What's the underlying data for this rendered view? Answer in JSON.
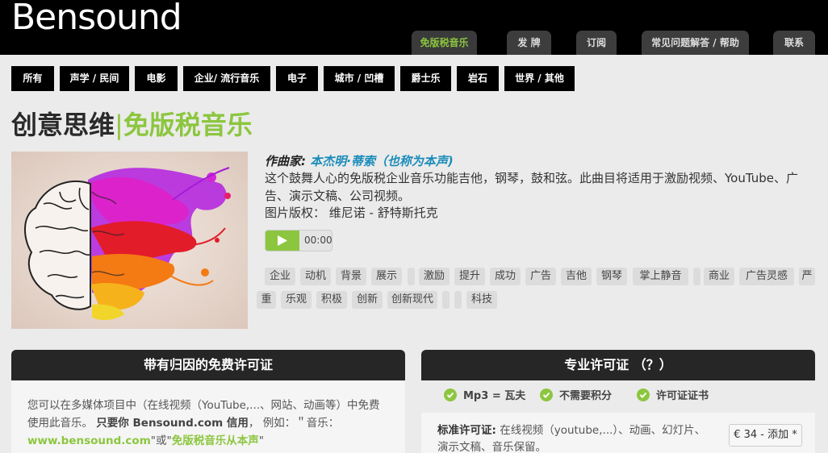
{
  "header": {
    "logo": "Bensound"
  },
  "nav": [
    {
      "label": "免版税音乐",
      "active": true
    },
    {
      "label": "发 牌",
      "active": false
    },
    {
      "label": "订阅",
      "active": false
    },
    {
      "label": "常见问题解答 / 帮助",
      "active": false
    },
    {
      "label": "联系",
      "active": false
    }
  ],
  "categories": [
    "所有",
    "声学 / 民间",
    "电影",
    "企业/ 流行音乐",
    "电子",
    "城市 / 凹槽",
    "爵士乐",
    "岩石",
    "世界 / 其他"
  ],
  "title": {
    "part1": "创意思维",
    "separator": "|",
    "part2": "免版税音乐"
  },
  "composer": {
    "label": "作曲家:",
    "value": "本杰明·蒂索（也称为本声)"
  },
  "description": "这个鼓舞人心的免版税企业音乐功能吉他，钢琴，鼓和弦。此曲目将适用于激励视频、YouTube、广告、演示文稿、公司视频。",
  "credit": "图片版权：  维尼诺 - 舒特斯托克",
  "player": {
    "time": "00:00"
  },
  "tags": [
    "企业",
    "动机",
    "背景",
    "展示",
    "",
    "激励",
    "提升",
    "成功",
    "广告",
    "吉他",
    "钢琴",
    "掌上静音",
    "",
    "商业",
    "广告灵感",
    "严",
    "重",
    "乐观",
    "积极",
    "创新",
    "创新现代",
    "",
    "科技"
  ],
  "free_license": {
    "title": "带有归因的免费许可证",
    "text1": "您可以在多媒体项目中（在线视频（YouTube,...、网站、动画等）中免费 使用此音乐。",
    "text_bold": "只要你 Bensound.com 信用",
    "text2": "， 例如：＂音乐：",
    "link1": "www.bensound.com",
    "text3": "\"或\"",
    "link2": "免版税音乐从本声",
    "text4": "\""
  },
  "pro_license": {
    "title": "专业许可证 （？）",
    "features": [
      "Mp3 = 瓦夫",
      "不需要积分",
      "许可证证书"
    ],
    "standard_label": "标准许可证:",
    "standard_text": "在线视频（youtube,...）、动画、幻灯片、演示文稿、音乐保留。",
    "price_button": "€ 34 - 添加 *"
  },
  "colors": {
    "accent": "#8cc63f",
    "link": "#1a8cba",
    "header_bg": "#000000",
    "page_bg": "#ebebeb"
  }
}
